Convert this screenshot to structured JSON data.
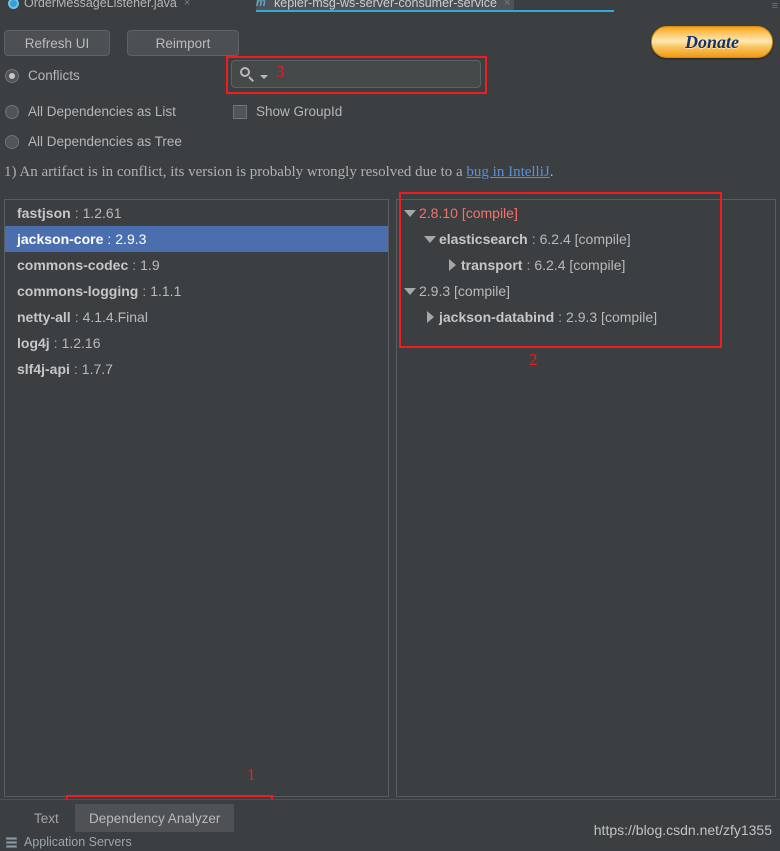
{
  "editor_tabs": [
    {
      "label": "OrderMessageListener.java",
      "icon": "java-class-icon",
      "active": false,
      "close": "×"
    },
    {
      "label": "kepler-msg-ws-server-consumer-service",
      "icon": "maven-pom-icon",
      "active": true,
      "close": "×"
    }
  ],
  "toolbar": {
    "refresh_label": "Refresh UI",
    "reimport_label": "Reimport",
    "donate_label": "Donate"
  },
  "options": {
    "radios": [
      {
        "label": "Conflicts",
        "selected": true
      },
      {
        "label": "All Dependencies as List",
        "selected": false
      },
      {
        "label": "All Dependencies as Tree",
        "selected": false
      }
    ],
    "checkbox": {
      "label": "Show GroupId",
      "checked": false
    },
    "search": {
      "value": "",
      "placeholder": ""
    }
  },
  "info": {
    "prefix": "1) An artifact is in conflict, its version is probably wrongly resolved due to a ",
    "link": "bug in IntelliJ",
    "suffix": "."
  },
  "dependency_list": [
    {
      "artifact": "fastjson",
      "separator": ":",
      "version": "1.2.61",
      "selected": false
    },
    {
      "artifact": "jackson-core",
      "separator": ":",
      "version": "2.9.3",
      "selected": true
    },
    {
      "artifact": "commons-codec",
      "separator": ":",
      "version": "1.9",
      "selected": false
    },
    {
      "artifact": "commons-logging",
      "separator": ":",
      "version": "1.1.1",
      "selected": false
    },
    {
      "artifact": "netty-all",
      "separator": ":",
      "version": "4.1.4.Final",
      "selected": false
    },
    {
      "artifact": "log4j",
      "separator": ":",
      "version": "1.2.16",
      "selected": false
    },
    {
      "artifact": "slf4j-api",
      "separator": ":",
      "version": "1.7.7",
      "selected": false
    }
  ],
  "dependency_tree": [
    {
      "indent": 0,
      "toggle": "expanded",
      "artifact": "",
      "separator": "",
      "version": "2.8.10 [compile]",
      "conflict": true
    },
    {
      "indent": 1,
      "toggle": "expanded",
      "artifact": "elasticsearch",
      "separator": ":",
      "version": "6.2.4 [compile]",
      "conflict": false
    },
    {
      "indent": 2,
      "toggle": "collapsed",
      "artifact": "transport",
      "separator": ":",
      "version": "6.2.4 [compile]",
      "conflict": false
    },
    {
      "indent": 0,
      "toggle": "expanded",
      "artifact": "",
      "separator": "",
      "version": "2.9.3 [compile]",
      "conflict": false
    },
    {
      "indent": 1,
      "toggle": "collapsed",
      "artifact": "jackson-databind",
      "separator": ":",
      "version": "2.9.3 [compile]",
      "conflict": false
    }
  ],
  "annotations": {
    "one": "1",
    "two": "2",
    "three": "3"
  },
  "bottom_tabs": [
    {
      "label": "Text",
      "active": false
    },
    {
      "label": "Dependency Analyzer",
      "active": true
    }
  ],
  "statusbar": {
    "app_servers_label": "Application Servers"
  },
  "watermark": "https://blog.csdn.net/zfy1355",
  "colors": {
    "background": "#3c3f41",
    "selection": "#4b6eaf",
    "accent_tab": "#2eaadc",
    "annotation_red": "#ef1d1d",
    "conflict_red": "#f0736a",
    "link_blue": "#5b8fd6",
    "donate_orange": "#f6a21c"
  }
}
